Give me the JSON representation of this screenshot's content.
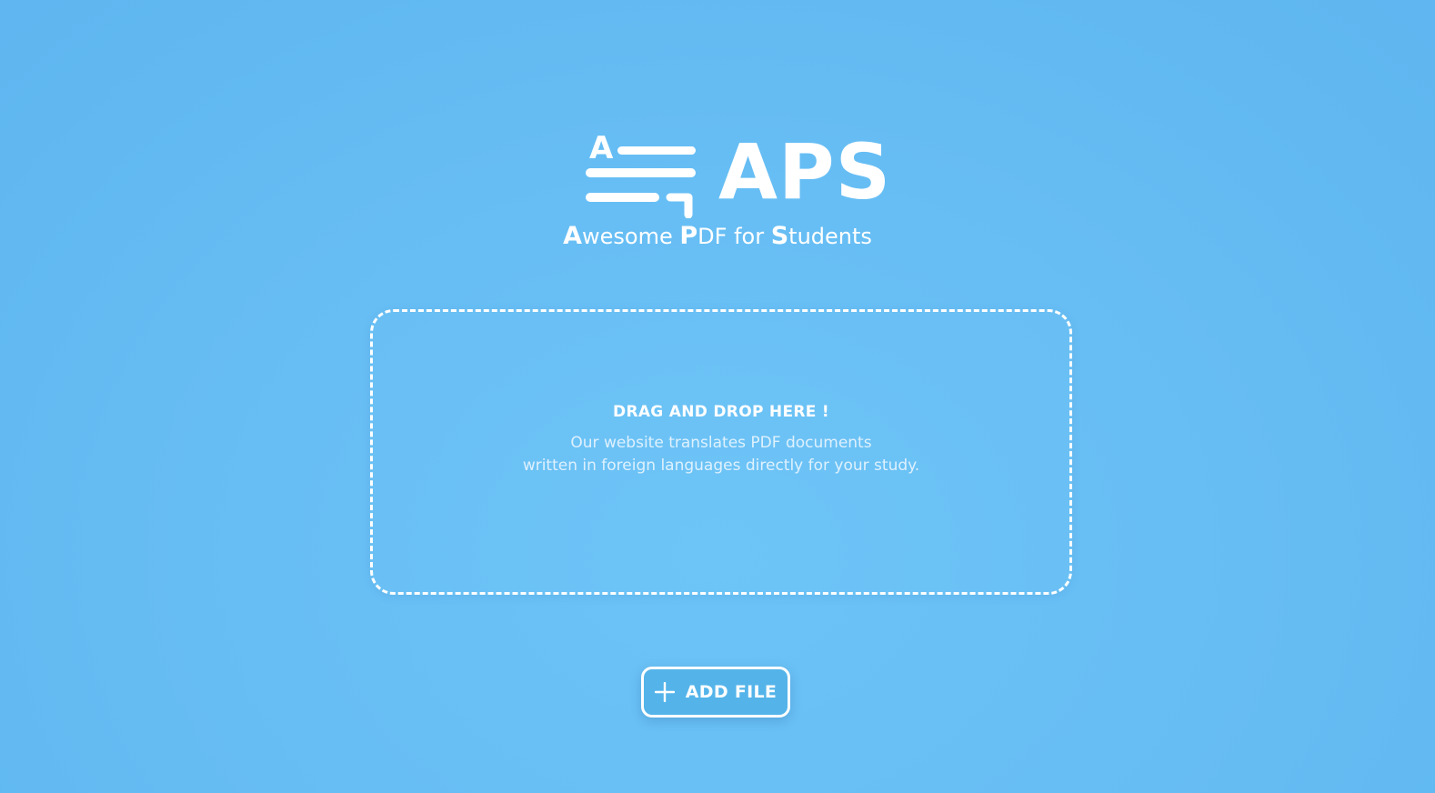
{
  "brand": {
    "name": "APS",
    "logo_mark_letter": "A",
    "tagline_parts": [
      {
        "text": "A",
        "bold": true
      },
      {
        "text": "wesome ",
        "bold": false
      },
      {
        "text": "P",
        "bold": true
      },
      {
        "text": "DF for ",
        "bold": false
      },
      {
        "text": "S",
        "bold": true
      },
      {
        "text": "tudents",
        "bold": false
      }
    ]
  },
  "dropzone": {
    "title": "DRAG AND DROP HERE !",
    "description_line1": "Our website translates PDF documents",
    "description_line2": "written in foreign languages directly for your study."
  },
  "actions": {
    "add_file_label": "ADD FILE",
    "add_file_icon": "plus-icon"
  },
  "colors": {
    "background": "#67bef4",
    "button": "#54b4ea",
    "foreground": "#ffffff"
  }
}
